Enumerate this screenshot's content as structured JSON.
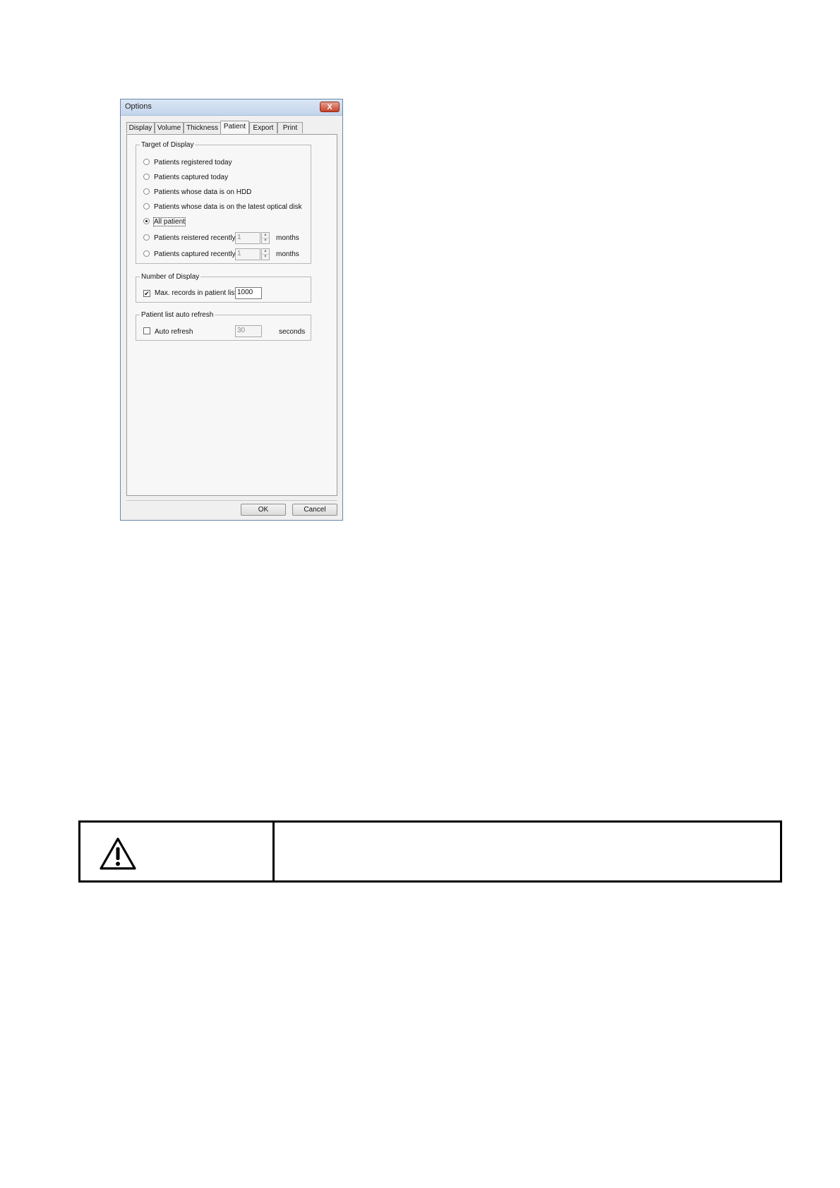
{
  "dialog": {
    "title": "Options",
    "close_label": "X",
    "tabs": [
      {
        "label": "Display"
      },
      {
        "label": "Volume"
      },
      {
        "label": "Thickness"
      },
      {
        "label": "Patient"
      },
      {
        "label": "Export"
      },
      {
        "label": "Print"
      }
    ],
    "active_tab": "Patient",
    "target_group": {
      "legend": "Target of Display",
      "options": [
        {
          "label": "Patients registered today",
          "checked": false
        },
        {
          "label": "Patients captured today",
          "checked": false
        },
        {
          "label": "Patients whose data is on HDD",
          "checked": false
        },
        {
          "label": "Patients whose data is on the latest optical disk",
          "checked": false
        },
        {
          "label": "All patient",
          "checked": true
        },
        {
          "label": "Patients reistered recently",
          "checked": false,
          "value": "1",
          "unit": "months"
        },
        {
          "label": "Patients captured recently",
          "checked": false,
          "value": "1",
          "unit": "months"
        }
      ]
    },
    "number_group": {
      "legend": "Number of Display",
      "max_records_label": "Max. records in patient list",
      "max_records_checked": true,
      "max_records_value": "1000"
    },
    "refresh_group": {
      "legend": "Patient list auto refresh",
      "auto_refresh_label": "Auto refresh",
      "auto_refresh_checked": false,
      "interval_value": "30",
      "interval_unit": "seconds"
    },
    "ok_label": "OK",
    "cancel_label": "Cancel"
  },
  "caution": {
    "icon": "warning-triangle-icon",
    "text": ""
  }
}
